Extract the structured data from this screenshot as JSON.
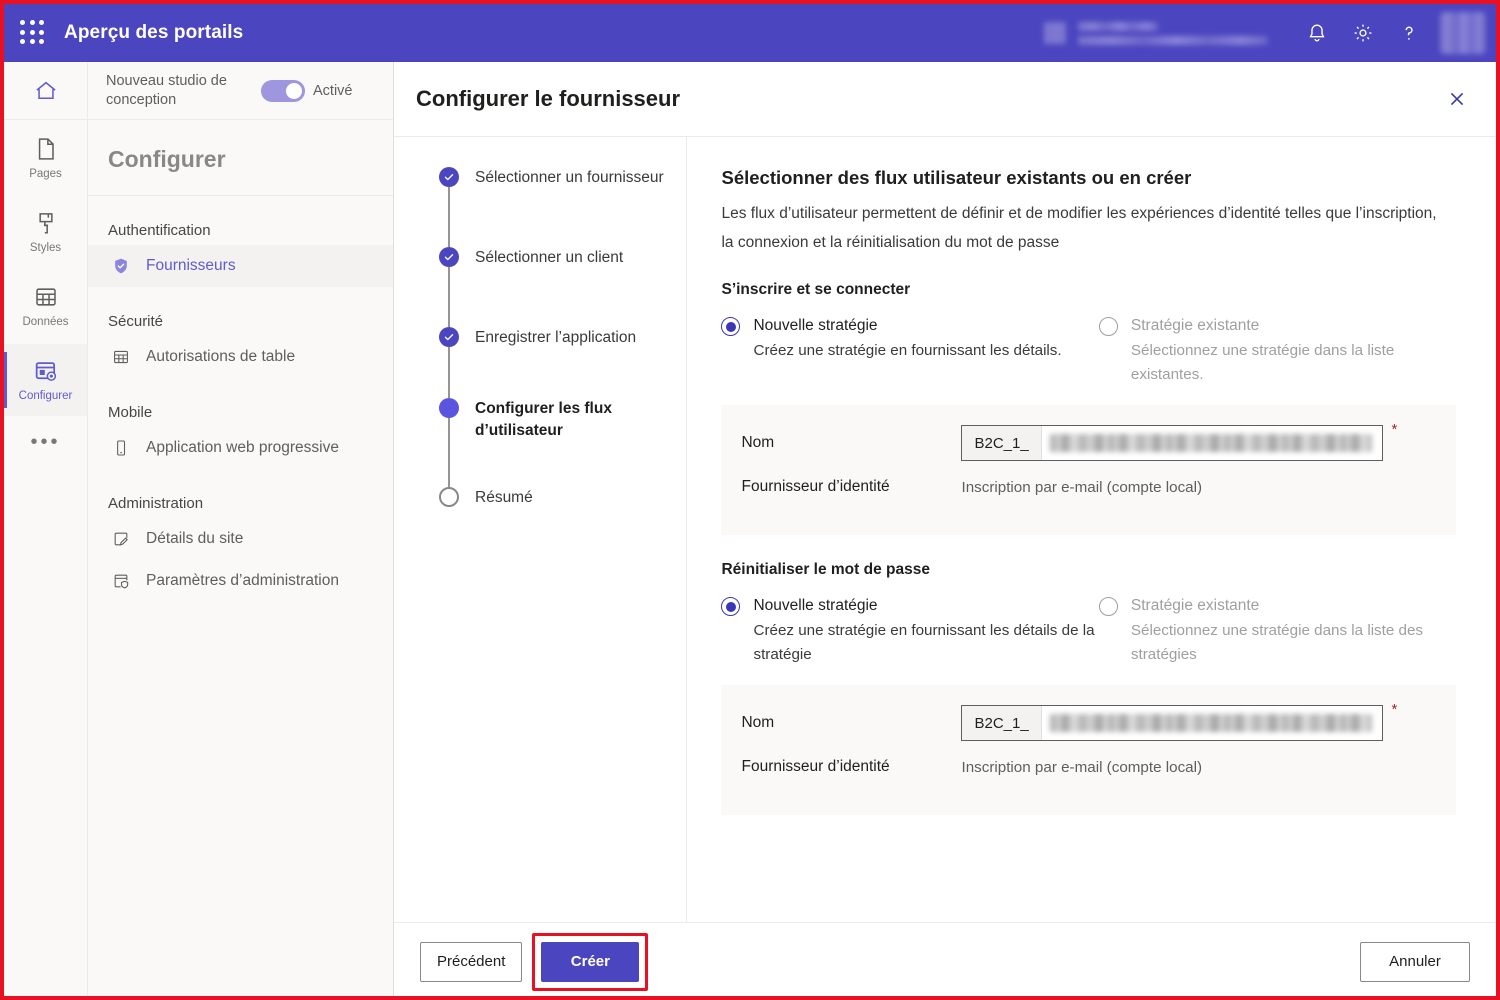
{
  "topbar": {
    "waffle_icon": "app-launcher-grid-icon",
    "app_title": "Aperçu des portails",
    "icons": [
      {
        "name": "notifications-bell-icon",
        "glyph": "bell"
      },
      {
        "name": "settings-gear-icon",
        "glyph": "gear"
      },
      {
        "name": "help-question-icon",
        "glyph": "?"
      }
    ],
    "accent_color": "#4b45bf"
  },
  "rail": {
    "home_icon": "home-icon",
    "items": [
      {
        "label": "Pages",
        "icon": "page-document-icon",
        "active": false
      },
      {
        "label": "Styles",
        "icon": "paint-brush-icon",
        "active": false
      },
      {
        "label": "Données",
        "icon": "table-grid-icon",
        "active": false
      },
      {
        "label": "Configurer",
        "icon": "configure-gear-window-icon",
        "active": true
      }
    ],
    "more_label": "•••"
  },
  "navpanel": {
    "studio_label": "Nouveau studio de conception",
    "toggle_state": "Activé",
    "toggle_on": true,
    "title": "Configurer",
    "groups": [
      {
        "title": "Authentification",
        "items": [
          {
            "label": "Fournisseurs",
            "icon": "shield-check-icon",
            "selected": true
          }
        ]
      },
      {
        "title": "Sécurité",
        "items": [
          {
            "label": "Autorisations de table",
            "icon": "table-grid-icon",
            "selected": false
          }
        ]
      },
      {
        "title": "Mobile",
        "items": [
          {
            "label": "Application web progressive",
            "icon": "mobile-phone-icon",
            "selected": false
          }
        ]
      },
      {
        "title": "Administration",
        "items": [
          {
            "label": "Détails du site",
            "icon": "edit-note-icon",
            "selected": false
          },
          {
            "label": "Paramètres d’administration",
            "icon": "admin-shield-icon",
            "selected": false
          }
        ]
      }
    ]
  },
  "dialog": {
    "title": "Configurer le fournisseur",
    "close_icon": "close-x-icon",
    "steps": [
      {
        "label": "Sélectionner un fournisseur",
        "state": "done"
      },
      {
        "label": "Sélectionner un client",
        "state": "done"
      },
      {
        "label": "Enregistrer l’application",
        "state": "done"
      },
      {
        "label": "Configurer les flux d’utilisateur",
        "state": "current"
      },
      {
        "label": "Résumé",
        "state": "todo"
      }
    ],
    "heading": "Sélectionner des flux utilisateur existants ou en créer",
    "description": "Les flux d’utilisateur permettent de définir et de modifier les expériences d’identité telles que l’inscription, la connexion et la réinitialisation du mot de passe",
    "sections": [
      {
        "title": "S’inscrire et se connecter",
        "option_new": {
          "title": "Nouvelle stratégie",
          "subtitle": "Créez une stratégie en fournissant les détails.",
          "selected": true
        },
        "option_existing": {
          "title": "Stratégie existante",
          "subtitle": "Sélectionnez une stratégie dans la liste existantes.",
          "selected": false,
          "disabled": true
        },
        "form": {
          "name_label": "Nom",
          "name_prefix": "B2C_1_",
          "name_value": "",
          "required": "*",
          "idp_label": "Fournisseur d’identité",
          "idp_value": "Inscription par e-mail (compte local)"
        }
      },
      {
        "title": "Réinitialiser le mot de passe",
        "option_new": {
          "title": "Nouvelle stratégie",
          "subtitle": "Créez une stratégie en fournissant les détails de la stratégie",
          "selected": true
        },
        "option_existing": {
          "title": "Stratégie existante",
          "subtitle": "Sélectionnez une stratégie dans la liste des stratégies",
          "selected": false,
          "disabled": true
        },
        "form": {
          "name_label": "Nom",
          "name_prefix": "B2C_1_",
          "name_value": "",
          "required": "*",
          "idp_label": "Fournisseur d’identité",
          "idp_value": "Inscription par e-mail (compte local)"
        }
      }
    ],
    "footer": {
      "previous_label": "Précédent",
      "create_label": "Créer",
      "cancel_label": "Annuler",
      "highlight_color": "#e81123"
    }
  }
}
